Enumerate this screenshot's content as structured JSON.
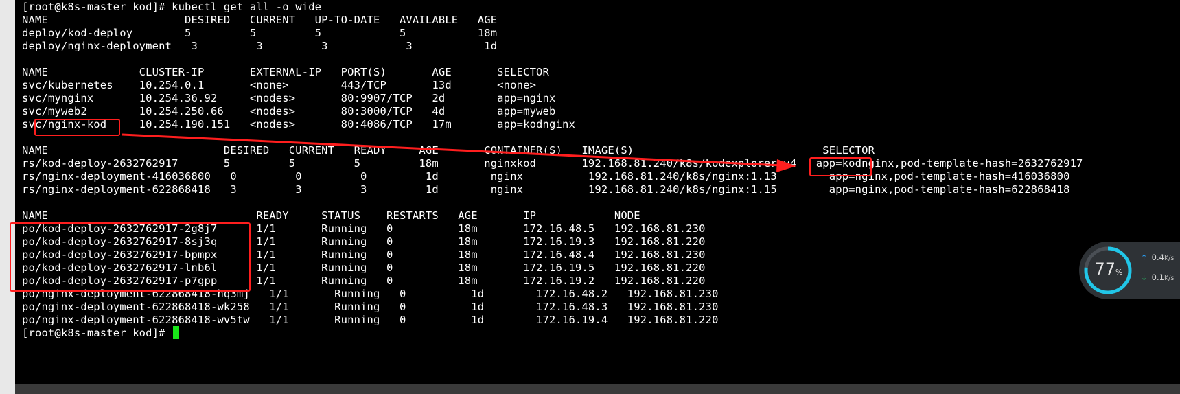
{
  "terminal": {
    "lines": [
      "[root@k8s-master kod]# kubectl get all -o wide",
      "NAME                     DESIRED   CURRENT   UP-TO-DATE   AVAILABLE   AGE",
      "deploy/kod-deploy        5         5         5            5           18m",
      "deploy/nginx-deployment   3         3         3            3           1d",
      "",
      "NAME              CLUSTER-IP       EXTERNAL-IP   PORT(S)       AGE       SELECTOR",
      "svc/kubernetes    10.254.0.1       <none>        443/TCP       13d       <none>",
      "svc/mynginx       10.254.36.92     <nodes>       80:9907/TCP   2d        app=nginx",
      "svc/myweb2        10.254.250.66    <nodes>       80:3000/TCP   4d        app=myweb",
      "svc/nginx-kod     10.254.190.151   <nodes>       80:4086/TCP   17m       app=kodnginx",
      "",
      "NAME                           DESIRED   CURRENT   READY     AGE       CONTAINER(S)   IMAGE(S)                             SELECTOR",
      "rs/kod-deploy-2632762917       5         5         5         18m       nginxkod       192.168.81.240/k8s/kodexplorer:v4   app=kodnginx,pod-template-hash=2632762917",
      "rs/nginx-deployment-416036800   0         0         0         1d        nginx          192.168.81.240/k8s/nginx:1.13        app=nginx,pod-template-hash=416036800",
      "rs/nginx-deployment-622868418   3         3         3         1d        nginx          192.168.81.240/k8s/nginx:1.15        app=nginx,pod-template-hash=622868418",
      "",
      "NAME                                READY     STATUS    RESTARTS   AGE       IP            NODE",
      "po/kod-deploy-2632762917-2g8j7      1/1       Running   0          18m       172.16.48.5   192.168.81.230",
      "po/kod-deploy-2632762917-8sj3q      1/1       Running   0          18m       172.16.19.3   192.168.81.220",
      "po/kod-deploy-2632762917-bpmpx      1/1       Running   0          18m       172.16.48.4   192.168.81.230",
      "po/kod-deploy-2632762917-lnb6l      1/1       Running   0          18m       172.16.19.5   192.168.81.220",
      "po/kod-deploy-2632762917-p7gpp      1/1       Running   0          18m       172.16.19.2   192.168.81.220",
      "po/nginx-deployment-622868418-hq3mj   1/1       Running   0          1d        172.16.48.2   192.168.81.230",
      "po/nginx-deployment-622868418-wk258   1/1       Running   0          1d        172.16.48.3   192.168.81.230",
      "po/nginx-deployment-622868418-wv5tw   1/1       Running   0          1d        172.16.19.4   192.168.81.220",
      "[root@k8s-master kod]# "
    ]
  },
  "net_widget": {
    "cpu_percent": "77",
    "cpu_unit": "%",
    "cpu_fraction": 0.77,
    "upload": "0.4",
    "upload_unit": "K/s",
    "download": "0.1",
    "download_unit": "K/s",
    "up_arrow": "↑",
    "down_arrow": "↓"
  },
  "colors": {
    "terminal_bg": "#000000",
    "terminal_fg": "#ffffff",
    "cursor": "#19e619",
    "annotation": "#ff1e1e",
    "gauge_track": "#4a4f55",
    "gauge_fill": "#21c6e8",
    "upload_arrow": "#2aa5ff",
    "download_arrow": "#2bd26e"
  },
  "icons": {
    "upload": "arrow-up-icon",
    "download": "arrow-down-icon"
  }
}
